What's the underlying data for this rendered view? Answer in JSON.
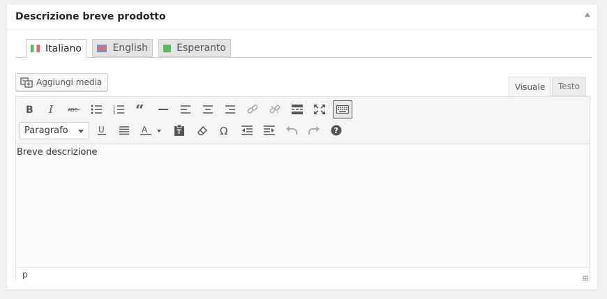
{
  "panel": {
    "title": "Descrizione breve prodotto"
  },
  "language_tabs": [
    {
      "label": "Italiano",
      "flag": "italy-flag-icon",
      "active": true
    },
    {
      "label": "English",
      "flag": "uk-flag-icon",
      "active": false
    },
    {
      "label": "Esperanto",
      "flag": "esperanto-flag-icon",
      "active": false
    }
  ],
  "media_button": {
    "label": "Aggiungi media",
    "icon": "add-media-icon"
  },
  "editor_tabs": {
    "visual": "Visuale",
    "text": "Testo",
    "active": "visual"
  },
  "toolbar": {
    "row1": [
      "bold",
      "italic",
      "strikethrough",
      "bullet-list",
      "numbered-list",
      "blockquote",
      "horizontal-line",
      "align-left",
      "align-center",
      "align-right",
      "insert-link",
      "remove-link",
      "read-more",
      "fullscreen",
      "toolbar-toggle"
    ],
    "format_select": "Paragrafo",
    "row2": [
      "underline",
      "justify",
      "text-color",
      "paste-as-text",
      "clear-formatting",
      "special-character",
      "outdent",
      "indent",
      "undo",
      "redo",
      "help"
    ]
  },
  "content": {
    "text": "Breve descrizione"
  },
  "status": {
    "path": "p"
  },
  "colors": {
    "background": "#f1f1f1",
    "panel": "#ffffff",
    "toolbar": "#f5f5f5",
    "icon": "#555555"
  }
}
